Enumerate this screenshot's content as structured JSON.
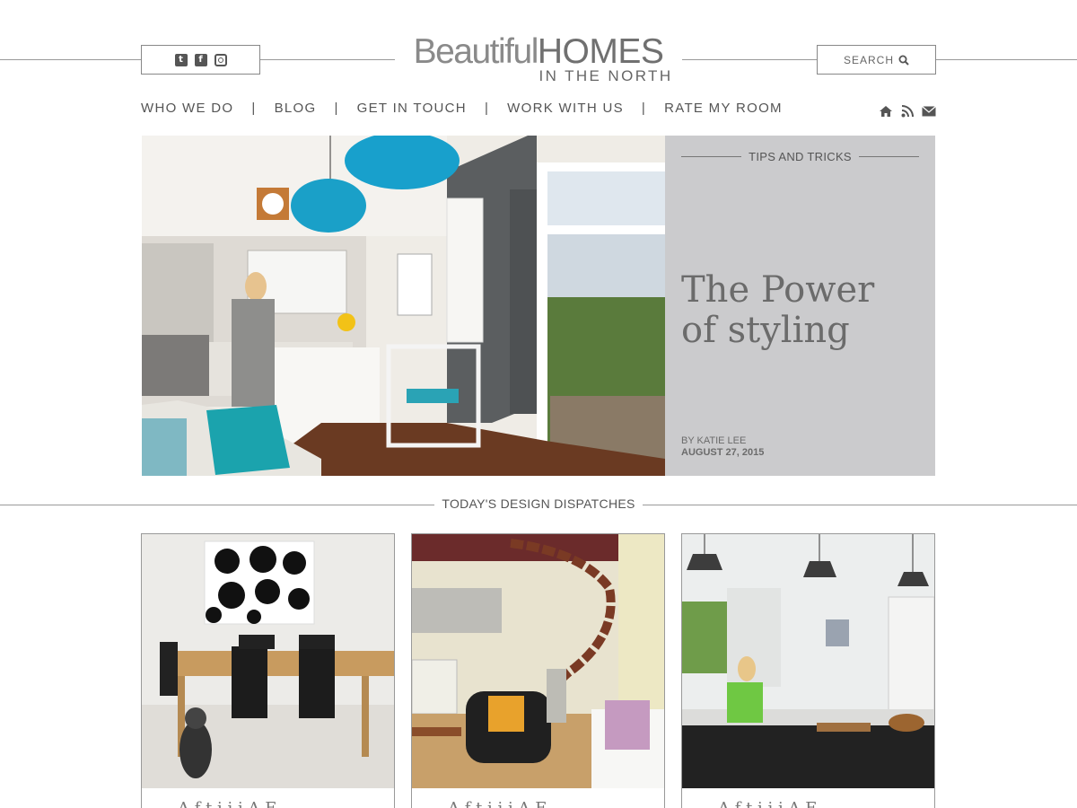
{
  "header": {
    "brand_part1": "Beautiful",
    "brand_part2": "HOMES",
    "brand_sub": "IN THE NORTH",
    "search_label": "SEARCH",
    "social_icons": [
      "twitter-icon",
      "facebook-icon",
      "instagram-icon"
    ]
  },
  "nav": {
    "items": [
      "WHO WE DO",
      "BLOG",
      "GET IN TOUCH",
      "WORK WITH US",
      "RATE MY ROOM"
    ],
    "separator": "|",
    "utility_icons": [
      "home-icon",
      "rss-icon",
      "mail-icon"
    ]
  },
  "hero": {
    "category": "TIPS AND TRICKS",
    "title_line1": "The Power",
    "title_line2": "of styling",
    "byline": "BY KATIE LEE",
    "date": "AUGUST 27, 2015"
  },
  "section": {
    "heading": "TODAY'S DESIGN DISPATCHES"
  },
  "cards": [
    {
      "caption": "A  f  t  i  i  i    A  E"
    },
    {
      "caption": "A  f  t  i  i  i    A  E"
    },
    {
      "caption": "A  f  t  i  i  i    A  E"
    }
  ],
  "colors": {
    "panel": "#cbcbcd",
    "accent_teal": "#1aa4c8",
    "text": "#666666"
  }
}
